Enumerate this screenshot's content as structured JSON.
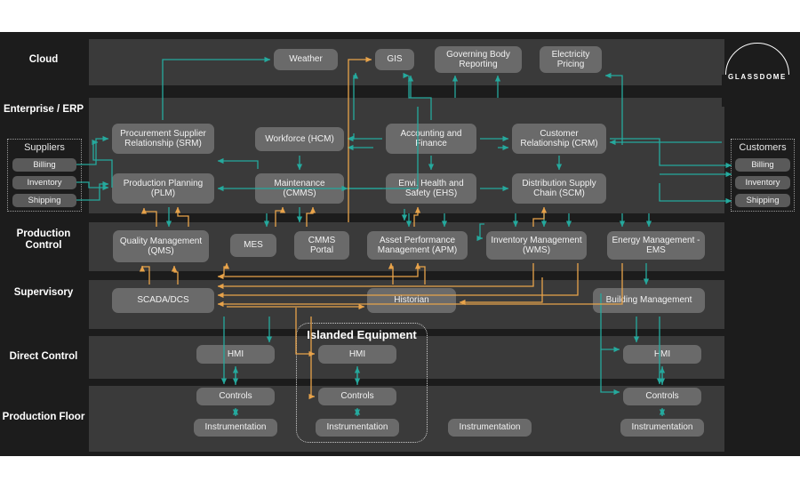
{
  "logo": {
    "name": "GLASSDOME"
  },
  "colors": {
    "teal": "#25a99d",
    "orange": "#e8a34a",
    "bg": "#1c1c1c",
    "band": "#3a3a3a",
    "node": "#6a6a6a"
  },
  "rows": [
    {
      "key": "cloud",
      "label": "Cloud"
    },
    {
      "key": "enterprise",
      "label": "Enterprise / ERP"
    },
    {
      "key": "production_control",
      "label": "Production\nControl"
    },
    {
      "key": "supervisory",
      "label": "Supervisory"
    },
    {
      "key": "direct_control",
      "label": "Direct Control"
    },
    {
      "key": "production_floor",
      "label": "Production Floor"
    }
  ],
  "panels": {
    "suppliers": {
      "title": "Suppliers",
      "items": [
        "Billing",
        "Inventory",
        "Shipping"
      ]
    },
    "customers": {
      "title": "Customers",
      "items": [
        "Billing",
        "Inventory",
        "Shipping"
      ]
    },
    "islanded": {
      "title": "Islanded Equipment",
      "items": [
        "HMI",
        "Controls",
        "Instrumentation"
      ]
    }
  },
  "nodes": {
    "cloud": [
      "Weather",
      "GIS",
      "Governing Body Reporting",
      "Electricity Pricing"
    ],
    "enterprise": [
      "Procurement Supplier Relationship (SRM)",
      "Workforce (HCM)",
      "Accounting  and Finance",
      "Customer Relationship (CRM)",
      "Production Planning (PLM)",
      "Maintenance (CMMS)",
      "Envi. Health and Safety (EHS)",
      "Distribution Supply Chain (SCM)"
    ],
    "production_control": [
      "Quality Management (QMS)",
      "MES",
      "CMMS Portal",
      "Asset Performance Management (APM)",
      "Inventory Management (WMS)",
      "Energy Management - EMS"
    ],
    "supervisory": [
      "SCADA/DCS",
      "Historian",
      "Building Management"
    ],
    "direct_control": [
      "HMI",
      "HMI",
      "HMI"
    ],
    "production_floor": [
      "Controls",
      "Instrumentation",
      "Controls",
      "Instrumentation",
      "Instrumentation",
      "Controls",
      "Instrumentation"
    ]
  }
}
